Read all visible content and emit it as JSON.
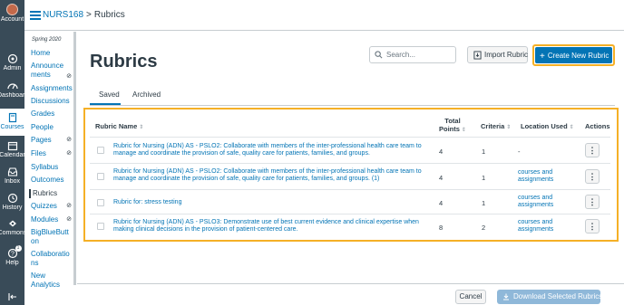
{
  "global_nav": {
    "items": [
      {
        "label": "Account",
        "icon": "avatar"
      },
      {
        "label": "Admin",
        "icon": "shield-icon"
      },
      {
        "label": "Dashboard",
        "icon": "dashboard-icon"
      },
      {
        "label": "Courses",
        "icon": "book-icon"
      },
      {
        "label": "Calendar",
        "icon": "calendar-icon"
      },
      {
        "label": "Inbox",
        "icon": "inbox-icon"
      },
      {
        "label": "History",
        "icon": "clock-icon"
      },
      {
        "label": "Commons",
        "icon": "commons-icon"
      },
      {
        "label": "Help",
        "icon": "help-icon"
      }
    ],
    "help_badge": "1",
    "collapse_icon": "collapse-arrow-icon",
    "active": "Courses"
  },
  "breadcrumb": {
    "course": "NURS168",
    "separator": ">",
    "current": "Rubrics"
  },
  "course_nav": {
    "term": "Spring 2020",
    "items": [
      {
        "label": "Home",
        "hidden_icon": false
      },
      {
        "label": "Announcements",
        "hidden_icon": true
      },
      {
        "label": "Assignments",
        "hidden_icon": false
      },
      {
        "label": "Discussions",
        "hidden_icon": false
      },
      {
        "label": "Grades",
        "hidden_icon": false
      },
      {
        "label": "People",
        "hidden_icon": false
      },
      {
        "label": "Pages",
        "hidden_icon": true
      },
      {
        "label": "Files",
        "hidden_icon": true
      },
      {
        "label": "Syllabus",
        "hidden_icon": false
      },
      {
        "label": "Outcomes",
        "hidden_icon": false
      },
      {
        "label": "Rubrics",
        "hidden_icon": false,
        "active": true
      },
      {
        "label": "Quizzes",
        "hidden_icon": true
      },
      {
        "label": "Modules",
        "hidden_icon": true
      },
      {
        "label": "BigBlueButton",
        "hidden_icon": false
      },
      {
        "label": "Collaborations",
        "hidden_icon": false
      },
      {
        "label": "New Analytics",
        "hidden_icon": false
      }
    ]
  },
  "page": {
    "title": "Rubrics",
    "search_placeholder": "Search...",
    "import_label": "Import Rubric",
    "create_label": "Create New Rubric",
    "create_plus": "+"
  },
  "tabs": {
    "saved": "Saved",
    "archived": "Archived",
    "active": "Saved"
  },
  "table": {
    "headers": {
      "name": "Rubric Name",
      "points_line1": "Total",
      "points_line2": "Points",
      "criteria": "Criteria",
      "location": "Location Used",
      "actions": "Actions"
    },
    "rows": [
      {
        "name": "Rubric for Nursing (ADN) AS - PSLO2: Collaborate with members of the inter-professional health care team to manage and coordinate the provision of safe, quality care for patients, families, and groups.",
        "points": "4",
        "criteria": "1",
        "location": "-"
      },
      {
        "name": "Rubric for Nursing (ADN) AS - PSLO2: Collaborate with members of the inter-professional health care team to manage and coordinate the provision of safe, quality care for patients, families, and groups. (1)",
        "points": "4",
        "criteria": "1",
        "location": "courses and assignments"
      },
      {
        "name": "Rubric for: stress testing",
        "points": "4",
        "criteria": "1",
        "location": "courses and assignments"
      },
      {
        "name": "Rubric for Nursing (ADN) AS - PSLO3: Demonstrate use of best current evidence and clinical expertise when making clinical decisions in the provision of patient-centered care.",
        "points": "8",
        "criteria": "2",
        "location": "courses and assignments"
      }
    ],
    "kebab": "⋮",
    "sort_icon": "⇕"
  },
  "footer": {
    "cancel": "Cancel",
    "download": "Download Selected Rubrics"
  },
  "colors": {
    "brand": "#0374b5",
    "nav_bg": "#394b58",
    "highlight": "#f5b026"
  }
}
